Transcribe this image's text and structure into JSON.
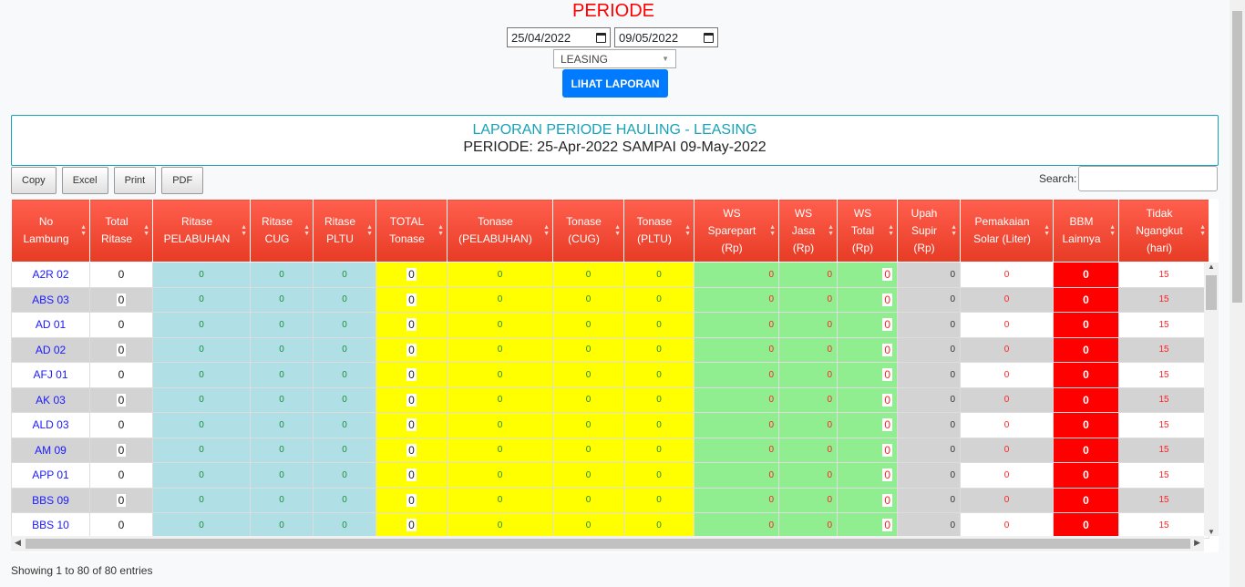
{
  "header": {
    "title": "PERIODE"
  },
  "filters": {
    "date_from": "25/04/2022",
    "date_to": "09/05/2022",
    "category": "LEASING",
    "submit_label": "LIHAT LAPORAN"
  },
  "report": {
    "title": "LAPORAN PERIODE HAULING - LEASING",
    "period": "PERIODE: 25-Apr-2022 SAMPAI 09-May-2022"
  },
  "toolbar": {
    "copy": "Copy",
    "excel": "Excel",
    "print": "Print",
    "pdf": "PDF",
    "search_label": "Search:"
  },
  "table": {
    "columns": [
      [
        "No",
        "Lambung"
      ],
      [
        "Total",
        "Ritase"
      ],
      [
        "Ritase",
        "PELABUHAN"
      ],
      [
        "Ritase",
        "CUG"
      ],
      [
        "Ritase",
        "PLTU"
      ],
      [
        "TOTAL",
        "Tonase"
      ],
      [
        "Tonase",
        "(PELABUHAN)"
      ],
      [
        "Tonase",
        "(CUG)"
      ],
      [
        "Tonase",
        "(PLTU)"
      ],
      [
        "WS",
        "Sparepart",
        "(Rp)"
      ],
      [
        "WS",
        "Jasa",
        "(Rp)"
      ],
      [
        "WS",
        "Total",
        "(Rp)"
      ],
      [
        "Upah",
        "Supir",
        "(Rp)"
      ],
      [
        "Pemakaian",
        "Solar (Liter)"
      ],
      [
        "BBM",
        "Lainnya"
      ],
      [
        "Tidak",
        "Ngangkut",
        "(hari)"
      ]
    ],
    "rows": [
      {
        "lambung": "A2R 02",
        "vals": [
          "0",
          "0",
          "0",
          "0",
          "0",
          "0",
          "0",
          "0",
          "0",
          "0",
          "0",
          "0",
          "0",
          "0",
          "15"
        ]
      },
      {
        "lambung": "ABS 03",
        "vals": [
          "0",
          "0",
          "0",
          "0",
          "0",
          "0",
          "0",
          "0",
          "0",
          "0",
          "0",
          "0",
          "0",
          "0",
          "15"
        ]
      },
      {
        "lambung": "AD 01",
        "vals": [
          "0",
          "0",
          "0",
          "0",
          "0",
          "0",
          "0",
          "0",
          "0",
          "0",
          "0",
          "0",
          "0",
          "0",
          "15"
        ]
      },
      {
        "lambung": "AD 02",
        "vals": [
          "0",
          "0",
          "0",
          "0",
          "0",
          "0",
          "0",
          "0",
          "0",
          "0",
          "0",
          "0",
          "0",
          "0",
          "15"
        ]
      },
      {
        "lambung": "AFJ 01",
        "vals": [
          "0",
          "0",
          "0",
          "0",
          "0",
          "0",
          "0",
          "0",
          "0",
          "0",
          "0",
          "0",
          "0",
          "0",
          "15"
        ]
      },
      {
        "lambung": "AK 03",
        "vals": [
          "0",
          "0",
          "0",
          "0",
          "0",
          "0",
          "0",
          "0",
          "0",
          "0",
          "0",
          "0",
          "0",
          "0",
          "15"
        ]
      },
      {
        "lambung": "ALD 03",
        "vals": [
          "0",
          "0",
          "0",
          "0",
          "0",
          "0",
          "0",
          "0",
          "0",
          "0",
          "0",
          "0",
          "0",
          "0",
          "15"
        ]
      },
      {
        "lambung": "AM 09",
        "vals": [
          "0",
          "0",
          "0",
          "0",
          "0",
          "0",
          "0",
          "0",
          "0",
          "0",
          "0",
          "0",
          "0",
          "0",
          "15"
        ]
      },
      {
        "lambung": "APP 01",
        "vals": [
          "0",
          "0",
          "0",
          "0",
          "0",
          "0",
          "0",
          "0",
          "0",
          "0",
          "0",
          "0",
          "0",
          "0",
          "15"
        ]
      },
      {
        "lambung": "BBS 09",
        "vals": [
          "0",
          "0",
          "0",
          "0",
          "0",
          "0",
          "0",
          "0",
          "0",
          "0",
          "0",
          "0",
          "0",
          "0",
          "15"
        ]
      },
      {
        "lambung": "BBS 10",
        "vals": [
          "0",
          "0",
          "0",
          "0",
          "0",
          "0",
          "0",
          "0",
          "0",
          "0",
          "0",
          "0",
          "0",
          "0",
          "15"
        ]
      }
    ]
  },
  "footer": {
    "info": "Showing 1 to 80 of 80 entries"
  },
  "icons": {
    "calendar": "calendar-icon",
    "sort": "sort-icon",
    "dropdown": "chevron-down-icon"
  }
}
